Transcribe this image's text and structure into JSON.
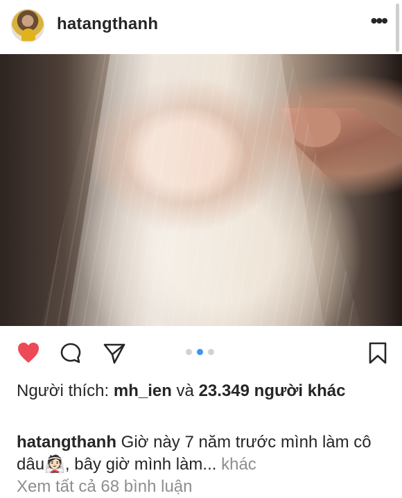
{
  "header": {
    "username": "hatangthanh",
    "more_label": "•••"
  },
  "post": {
    "image_description_icon": "bride-veil-photo",
    "carousel": {
      "count": 3,
      "active_index": 1
    }
  },
  "likes": {
    "prefix": "Người thích: ",
    "user": "mh_ien",
    "conj": " và ",
    "count_text": "23.349 người khác"
  },
  "caption": {
    "username": "hatangthanh",
    "text": " Giờ này 7 năm trước mình làm cô dâu👰🏻, bây giờ mình làm...",
    "more": " khác"
  },
  "comments_link": "Xem tất cả 68 bình luận",
  "icons": {
    "heart": "heart-icon",
    "comment": "comment-icon",
    "share": "share-icon",
    "bookmark": "bookmark-icon"
  },
  "colors": {
    "heart": "#ed4956",
    "accent": "#3897f0",
    "text": "#262626",
    "muted": "#8e8e8e"
  }
}
